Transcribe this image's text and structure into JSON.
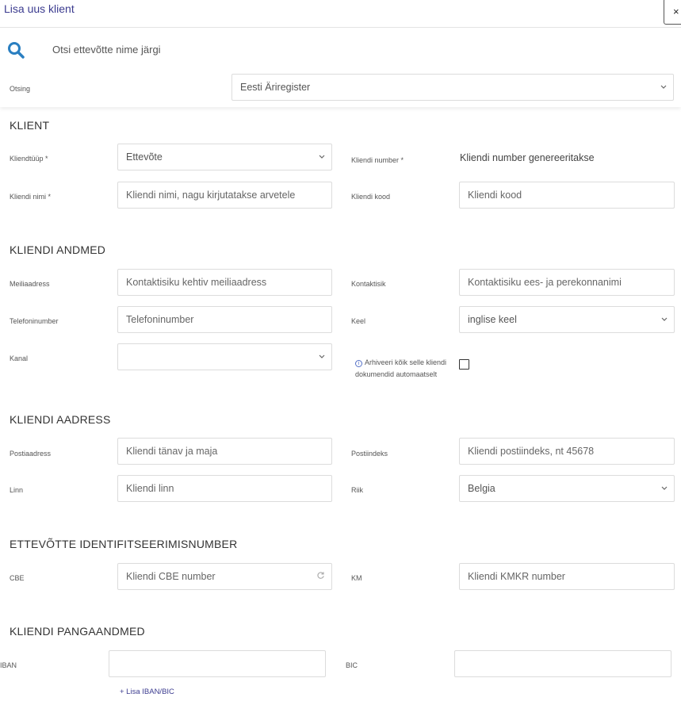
{
  "window": {
    "title": "Lisa uus klient",
    "close_label": "×"
  },
  "search": {
    "label": "Otsi ettevõtte nime järgi",
    "source_label": "Otsing",
    "source_value": "Eesti Äriregister"
  },
  "client": {
    "heading": "KLIENT",
    "type_label": "Kliendtüüp *",
    "type_value": "Ettevõte",
    "number_label": "Kliendi number *",
    "number_value": "Kliendi number genereeritakse",
    "name_label": "Kliendi nimi *",
    "name_placeholder": "Kliendi nimi, nagu kirjutatakse arvetele",
    "code_label": "Kliendi kood",
    "code_placeholder": "Kliendi kood"
  },
  "details": {
    "heading": "KLIENDI ANDMED",
    "email_label": "Meiliaadress",
    "email_placeholder": "Kontaktisiku kehtiv meiliaadress",
    "contact_label": "Kontaktisik",
    "contact_placeholder": "Kontaktisiku ees- ja perekonnanimi",
    "phone_label": "Telefoninumber",
    "phone_placeholder": "Telefoninumber",
    "language_label": "Keel",
    "language_value": "inglise keel",
    "channel_label": "Kanal",
    "channel_value": "",
    "archive_text": "Arhiveeri kõik selle kliendi dokumendid automaatselt",
    "info_symbol": "i"
  },
  "address": {
    "heading": "KLIENDI AADRESS",
    "street_label": "Postiaadress",
    "street_placeholder": "Kliendi tänav ja maja",
    "postal_label": "Postiindeks",
    "postal_placeholder": "Kliendi postiindeks, nt 45678",
    "city_label": "Linn",
    "city_placeholder": "Kliendi linn",
    "country_label": "Riik",
    "country_value": "Belgia"
  },
  "company_id": {
    "heading": "ETTEVÕTTE IDENTIFITSEERIMISNUMBER",
    "cbe_label": "CBE",
    "cbe_placeholder": "Kliendi CBE number",
    "vat_label": "KM",
    "vat_placeholder": "Kliendi KMKR number"
  },
  "bank": {
    "heading": "KLIENDI PANGAANDMED",
    "iban_label": "IBAN",
    "iban_value": "",
    "bic_label": "BIC",
    "bic_value": "",
    "add_label": "+ Lisa IBAN/BIC"
  },
  "colors": {
    "accent": "#3b3b8f",
    "search_icon": "#2a7fc1",
    "border": "#dcdcdc"
  }
}
